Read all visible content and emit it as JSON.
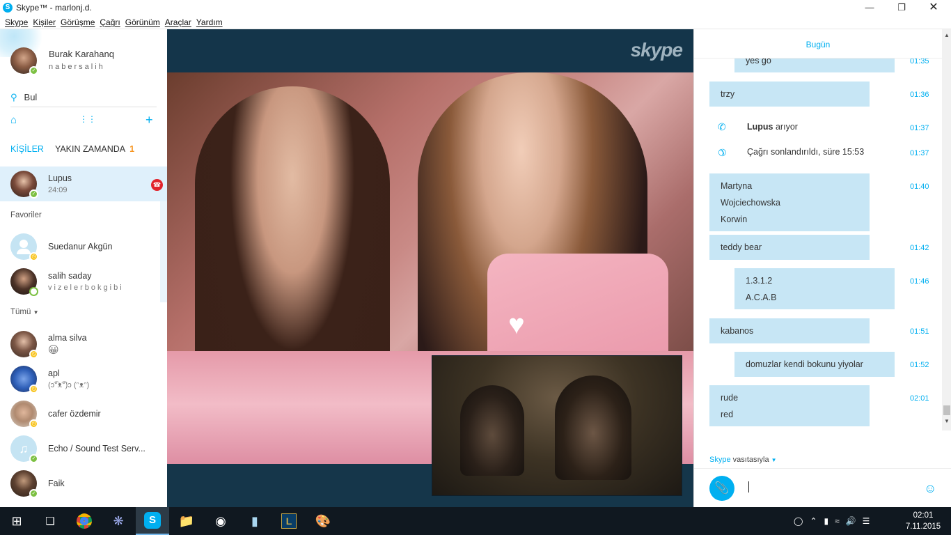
{
  "window": {
    "title": "Skype™ - marlonj.d.",
    "app_icon": "S"
  },
  "menu": [
    "Skype",
    "Kişiler",
    "Görüşme",
    "Çağrı",
    "Görünüm",
    "Araçlar",
    "Yardım"
  ],
  "profile": {
    "name": "Burak Karahanq",
    "mood": "nabersalih"
  },
  "search": {
    "label": "Bul"
  },
  "tabs": {
    "contacts": "KİŞİLER",
    "recent": "YAKIN ZAMANDA",
    "recent_count": "1"
  },
  "active_call": {
    "name": "Lupus",
    "duration": "24:09"
  },
  "sections": {
    "favorites": "Favoriler",
    "all": "Tümü"
  },
  "favorites": [
    {
      "name": "Suedanur Akgün",
      "sub": ""
    },
    {
      "name": "salih saday",
      "sub": "vizelerbokgibi"
    }
  ],
  "contacts": [
    {
      "name": "alma silva",
      "sub": "😀"
    },
    {
      "name": "apl",
      "sub": "(ↄ͡°ᴥ͡°)ↄ (ᵔᴥᵔ)"
    },
    {
      "name": "cafer özdemir",
      "sub": ""
    },
    {
      "name": "Echo / Sound Test Serv...",
      "sub": ""
    },
    {
      "name": "Faik",
      "sub": ""
    }
  ],
  "video": {
    "logo": "skype"
  },
  "chat": {
    "date": "Bugün",
    "messages": [
      {
        "text": "yes go",
        "time": "01:35"
      },
      {
        "text": "trzy",
        "time": "01:36"
      },
      {
        "text": "Martyna",
        "text2": "Wojciechowska",
        "text3": "Korwin",
        "time": "01:40"
      },
      {
        "text": "teddy bear",
        "time": "01:42"
      },
      {
        "text": "1.3.1.2",
        "text2": "A.C.A.B",
        "time": "01:46"
      },
      {
        "text": "kabanos",
        "time": "01:51"
      },
      {
        "text": "domuzlar kendi bokunu yiyolar",
        "time": "01:52"
      },
      {
        "text": "rude",
        "text2": "red",
        "time": "02:01"
      }
    ],
    "events": [
      {
        "who": "Lupus",
        "text": "arıyor",
        "time": "01:37"
      },
      {
        "text": "Çağrı sonlandırıldı, süre 15:53",
        "time": "01:37"
      }
    ],
    "via": {
      "brand": "Skype",
      "text": "vasıtasıyla"
    }
  },
  "taskbar": {
    "time": "02:01",
    "date": "7.11.2015"
  },
  "colors": {
    "accent": "#00aff0",
    "bubble": "#c7e6f5",
    "end_call": "#e1242c",
    "online": "#7cc042",
    "away": "#f8c31a",
    "taskbar": "#101820"
  }
}
